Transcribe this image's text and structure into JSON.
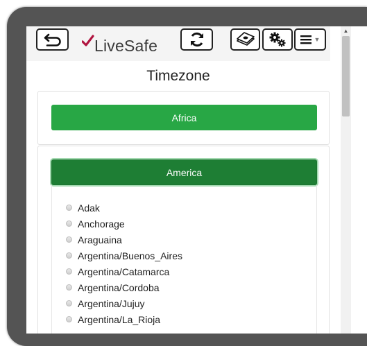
{
  "header": {
    "back_icon": "undo-arrow-icon",
    "logo_text": "LiveSafe",
    "logo_icon": "check-mark-icon",
    "refresh_icon": "refresh-icon",
    "money_icon": "money-stack-icon",
    "settings_icon": "gears-icon",
    "menu_icon": "hamburger-icon"
  },
  "page": {
    "title": "Timezone"
  },
  "regions": [
    {
      "label": "Africa",
      "expanded": false
    },
    {
      "label": "America",
      "expanded": true
    }
  ],
  "america_timezones": [
    "Adak",
    "Anchorage",
    "Araguaina",
    "Argentina/Buenos_Aires",
    "Argentina/Catamarca",
    "Argentina/Cordoba",
    "Argentina/Jujuy",
    "Argentina/La_Rioja"
  ],
  "colors": {
    "africa_button": "#28a745",
    "america_button": "#1e7e34",
    "device_frame": "#545454"
  }
}
